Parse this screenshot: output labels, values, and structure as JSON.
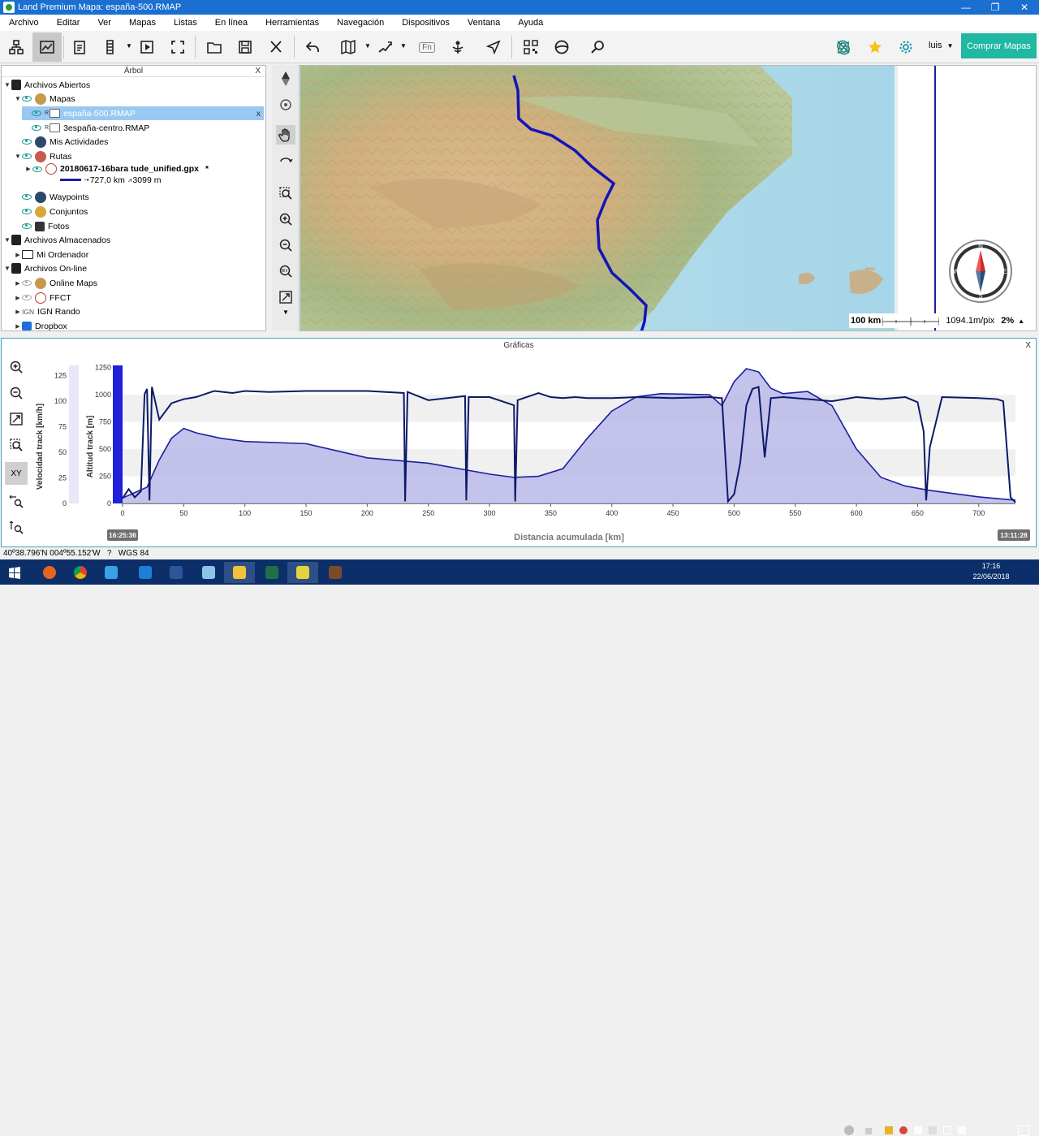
{
  "window": {
    "title": "Land Premium Mapa: españa-500.RMAP",
    "min": "—",
    "max": "❐",
    "close": "✕"
  },
  "menu": [
    "Archivo",
    "Editar",
    "Ver",
    "Mapas",
    "Listas",
    "En línea",
    "Herramientas",
    "Navegación",
    "Dispositivos",
    "Ventana",
    "Ayuda"
  ],
  "toolbar": {
    "user": "luis",
    "user_caret": "▼",
    "buy_label": "Comprar Mapas",
    "fn_label": "Fn",
    "dropdown_caret": "▼"
  },
  "tree": {
    "title": "Árbol",
    "close": "X",
    "items": [
      {
        "label": "Archivos Abiertos"
      },
      {
        "label": "Mapas"
      },
      {
        "label": "españa-500.RMAP",
        "badge": "R",
        "close": "x"
      },
      {
        "label": "3españa-centro.RMAP",
        "badge": "R"
      },
      {
        "label": "Mis Actividades"
      },
      {
        "label": "Rutas"
      },
      {
        "label": "20180617-16bara tude_unified.gpx",
        "modified": "*"
      },
      {
        "label": "727,0 km",
        "elevation": "3099 m"
      },
      {
        "label": "Waypoints"
      },
      {
        "label": "Conjuntos"
      },
      {
        "label": "Fotos"
      },
      {
        "label": "Archivos Almacenados"
      },
      {
        "label": "Mi Ordenador"
      },
      {
        "label": "Archivos On-line"
      },
      {
        "label": "Online Maps"
      },
      {
        "label": "FFCT"
      },
      {
        "label": "IGN Rando",
        "badge": "IGN"
      },
      {
        "label": "Dropbox"
      }
    ]
  },
  "map": {
    "scale_label": "100 km",
    "resolution": "1094.1m/pix",
    "zoom": "2%",
    "zoom_caret": "▲",
    "compass": {
      "n": "N",
      "e": "E",
      "s": "S",
      "w": "W"
    }
  },
  "charts": {
    "title": "Gráficas",
    "close": "X",
    "tool_xy": "XY",
    "start_time": "16:25:36",
    "end_time": "13:11:28"
  },
  "chart_data": {
    "type": "line",
    "xlabel": "Distancia acumulada [km]",
    "ylabel_left": "Velocidad track [km/h]",
    "ylabel_right": "Altitud track [m]",
    "xlim": [
      0,
      730
    ],
    "x_ticks": [
      0,
      50,
      100,
      150,
      200,
      250,
      300,
      350,
      400,
      450,
      500,
      550,
      600,
      650,
      700
    ],
    "speed_ylim": [
      0,
      135
    ],
    "speed_ticks": [
      0,
      25,
      50,
      75,
      100,
      125
    ],
    "altitude_ylim": [
      0,
      1270
    ],
    "altitude_ticks": [
      0,
      250,
      500,
      750,
      1000,
      1250
    ],
    "series": [
      {
        "color": "#0d1a6a",
        "x": [
          0,
          5,
          10,
          15,
          18,
          20,
          22,
          24,
          30,
          40,
          50,
          60,
          75,
          90,
          100,
          120,
          150,
          200,
          230,
          231,
          233,
          250,
          280,
          281,
          283,
          300,
          320,
          321,
          323,
          340,
          350,
          360,
          370,
          380,
          400,
          420,
          450,
          480,
          490,
          495,
          500,
          505,
          510,
          515,
          520,
          525,
          530,
          540,
          550,
          560,
          580,
          600,
          620,
          640,
          650,
          655,
          657,
          660,
          670,
          700,
          715,
          720,
          726,
          730
        ],
        "values": [
          5,
          14,
          6,
          12,
          107,
          112,
          3,
          114,
          82,
          98,
          102,
          104,
          110,
          108,
          110,
          109,
          110,
          110,
          108,
          2,
          109,
          101,
          105,
          3,
          104,
          104,
          96,
          2,
          101,
          108,
          104,
          103,
          104,
          103,
          103,
          104,
          103,
          104,
          103,
          2,
          9,
          40,
          96,
          112,
          114,
          45,
          103,
          104,
          103,
          102,
          100,
          104,
          102,
          104,
          99,
          70,
          3,
          55,
          104,
          103,
          102,
          100,
          6,
          1
        ]
      },
      {
        "color": "#1a1fa0",
        "fill": "#b9b9e9",
        "x": [
          0,
          10,
          20,
          30,
          40,
          50,
          60,
          80,
          100,
          150,
          200,
          250,
          300,
          320,
          340,
          360,
          380,
          400,
          420,
          440,
          460,
          480,
          490,
          500,
          510,
          520,
          530,
          540,
          560,
          580,
          600,
          620,
          640,
          660,
          680,
          700,
          720,
          730
        ],
        "values": [
          50,
          100,
          150,
          400,
          600,
          690,
          650,
          600,
          570,
          550,
          420,
          370,
          270,
          240,
          250,
          320,
          600,
          850,
          980,
          1010,
          1005,
          1000,
          900,
          1120,
          1240,
          1210,
          1060,
          1010,
          1030,
          900,
          500,
          240,
          160,
          120,
          90,
          60,
          40,
          30
        ]
      }
    ]
  },
  "status": {
    "coords": "40º38.796'N 004º55.152'W",
    "help": "?",
    "datum": "WGS 84"
  },
  "taskbar": {
    "time": "17:16",
    "date": "22/06/2018"
  }
}
